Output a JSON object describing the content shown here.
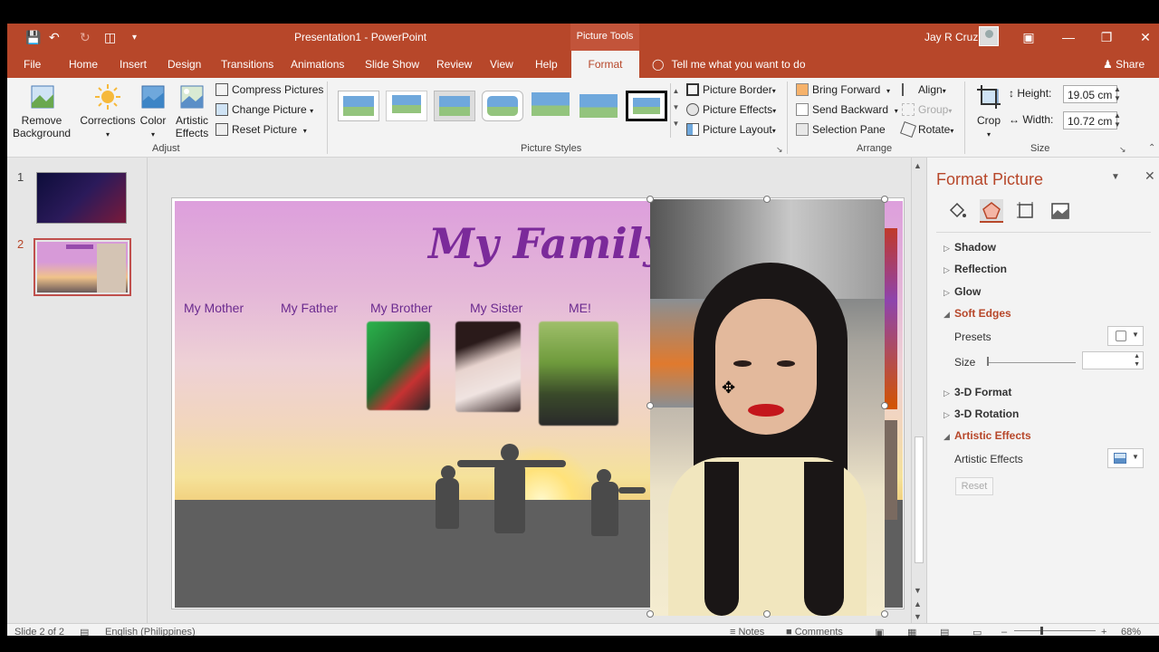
{
  "titlebar": {
    "doc_title": "Presentation1 - PowerPoint",
    "contextual_tab_group": "Picture Tools",
    "user_name": "Jay R Cruz"
  },
  "tabs": [
    {
      "label": "File"
    },
    {
      "label": "Home"
    },
    {
      "label": "Insert"
    },
    {
      "label": "Design"
    },
    {
      "label": "Transitions"
    },
    {
      "label": "Animations"
    },
    {
      "label": "Slide Show"
    },
    {
      "label": "Review"
    },
    {
      "label": "View"
    },
    {
      "label": "Help"
    },
    {
      "label": "Format",
      "active": true
    }
  ],
  "tell_me": "Tell me what you want to do",
  "share": "Share",
  "ribbon": {
    "adjust": {
      "remove_background": "Remove Background",
      "corrections": "Corrections",
      "color": "Color",
      "artistic_effects": "Artistic Effects",
      "compress_pictures": "Compress Pictures",
      "change_picture": "Change Picture",
      "reset_picture": "Reset Picture",
      "group_label": "Adjust"
    },
    "picture_styles": {
      "group_label": "Picture Styles",
      "picture_border": "Picture Border",
      "picture_effects": "Picture Effects",
      "picture_layout": "Picture Layout"
    },
    "arrange": {
      "bring_forward": "Bring Forward",
      "send_backward": "Send Backward",
      "selection_pane": "Selection Pane",
      "align": "Align",
      "group": "Group",
      "rotate": "Rotate",
      "group_label": "Arrange"
    },
    "size": {
      "crop": "Crop",
      "height_label": "Height:",
      "height_value": "19.05 cm",
      "width_label": "Width:",
      "width_value": "10.72 cm",
      "group_label": "Size"
    }
  },
  "thumbnails": [
    {
      "number": "1"
    },
    {
      "number": "2",
      "active": true
    }
  ],
  "slide": {
    "title": "My Family",
    "members": [
      "My Mother",
      "My Father",
      "My Brother",
      "My Sister",
      "ME!"
    ]
  },
  "format_pane": {
    "title": "Format Picture",
    "sections": {
      "shadow": "Shadow",
      "reflection": "Reflection",
      "glow": "Glow",
      "soft_edges": "Soft Edges",
      "presets": "Presets",
      "size": "Size",
      "format_3d": "3-D Format",
      "rotation_3d": "3-D Rotation",
      "artistic_effects": "Artistic Effects",
      "artistic_effects_sub": "Artistic Effects",
      "reset": "Reset"
    }
  },
  "statusbar": {
    "slide_info": "Slide 2 of 2",
    "language": "English (Philippines)",
    "notes": "Notes",
    "comments": "Comments",
    "zoom": "68%"
  },
  "colors": {
    "accent": "#b7472a",
    "title_purple": "#7b2a9a"
  }
}
